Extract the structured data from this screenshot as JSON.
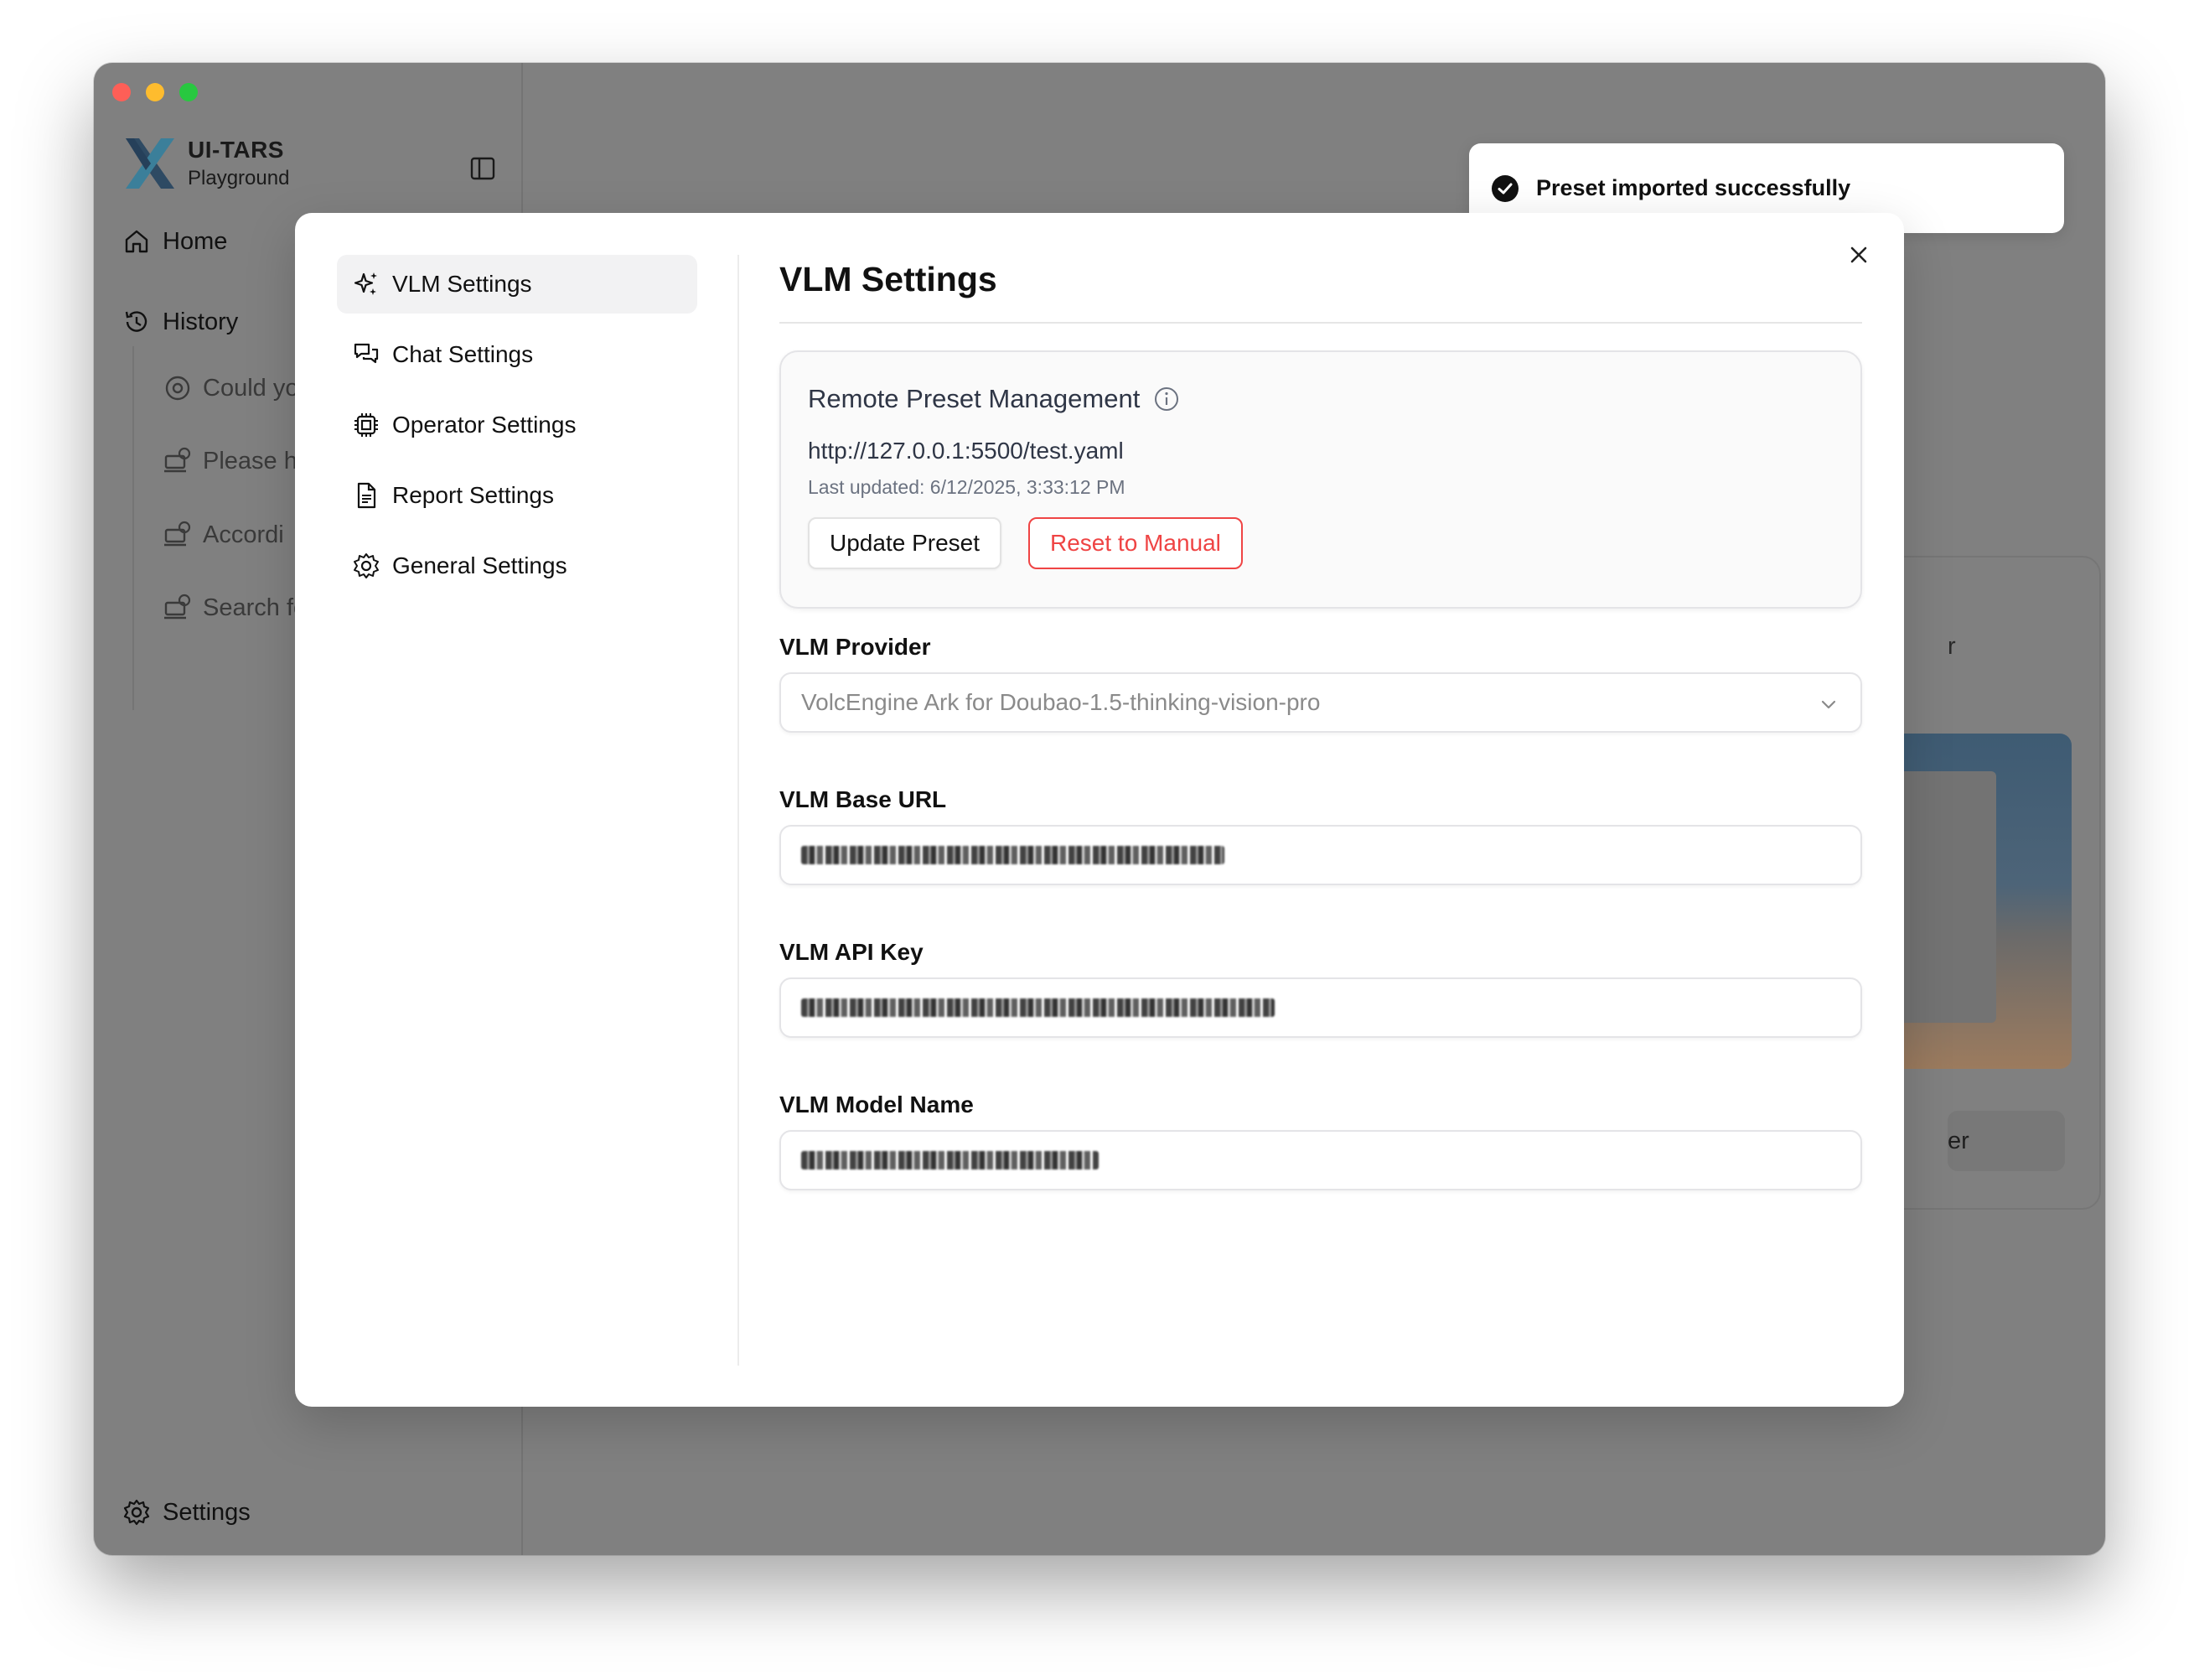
{
  "app": {
    "title": "UI-TARS",
    "subtitle": "Playground"
  },
  "sidebar": {
    "home_label": "Home",
    "history_label": "History",
    "history_items": [
      "Could yo",
      "Please h",
      "Accordi",
      "Search fo"
    ],
    "settings_label": "Settings"
  },
  "background": {
    "card_text_fragment": "r",
    "button_text_fragment": "er"
  },
  "toast": {
    "message": "Preset imported successfully"
  },
  "dialog": {
    "menu": [
      {
        "label": "VLM Settings",
        "icon": "sparkles-icon",
        "active": true
      },
      {
        "label": "Chat Settings",
        "icon": "chat-bubbles-icon",
        "active": false
      },
      {
        "label": "Operator Settings",
        "icon": "cpu-chip-icon",
        "active": false
      },
      {
        "label": "Report Settings",
        "icon": "document-icon",
        "active": false
      },
      {
        "label": "General Settings",
        "icon": "gear-icon",
        "active": false
      }
    ],
    "title": "VLM Settings",
    "preset": {
      "heading": "Remote Preset Management",
      "url": "http://127.0.0.1:5500/test.yaml",
      "last_updated": "Last updated: 6/12/2025, 3:33:12 PM",
      "update_label": "Update Preset",
      "reset_label": "Reset to Manual"
    },
    "fields": {
      "provider_label": "VLM Provider",
      "provider_value": "VolcEngine Ark for Doubao-1.5-thinking-vision-pro",
      "base_url_label": "VLM Base URL",
      "api_key_label": "VLM API Key",
      "model_name_label": "VLM Model Name"
    }
  },
  "colors": {
    "accent_danger": "#ef4444",
    "toast_check": "#111111",
    "overlay": "#808080"
  }
}
